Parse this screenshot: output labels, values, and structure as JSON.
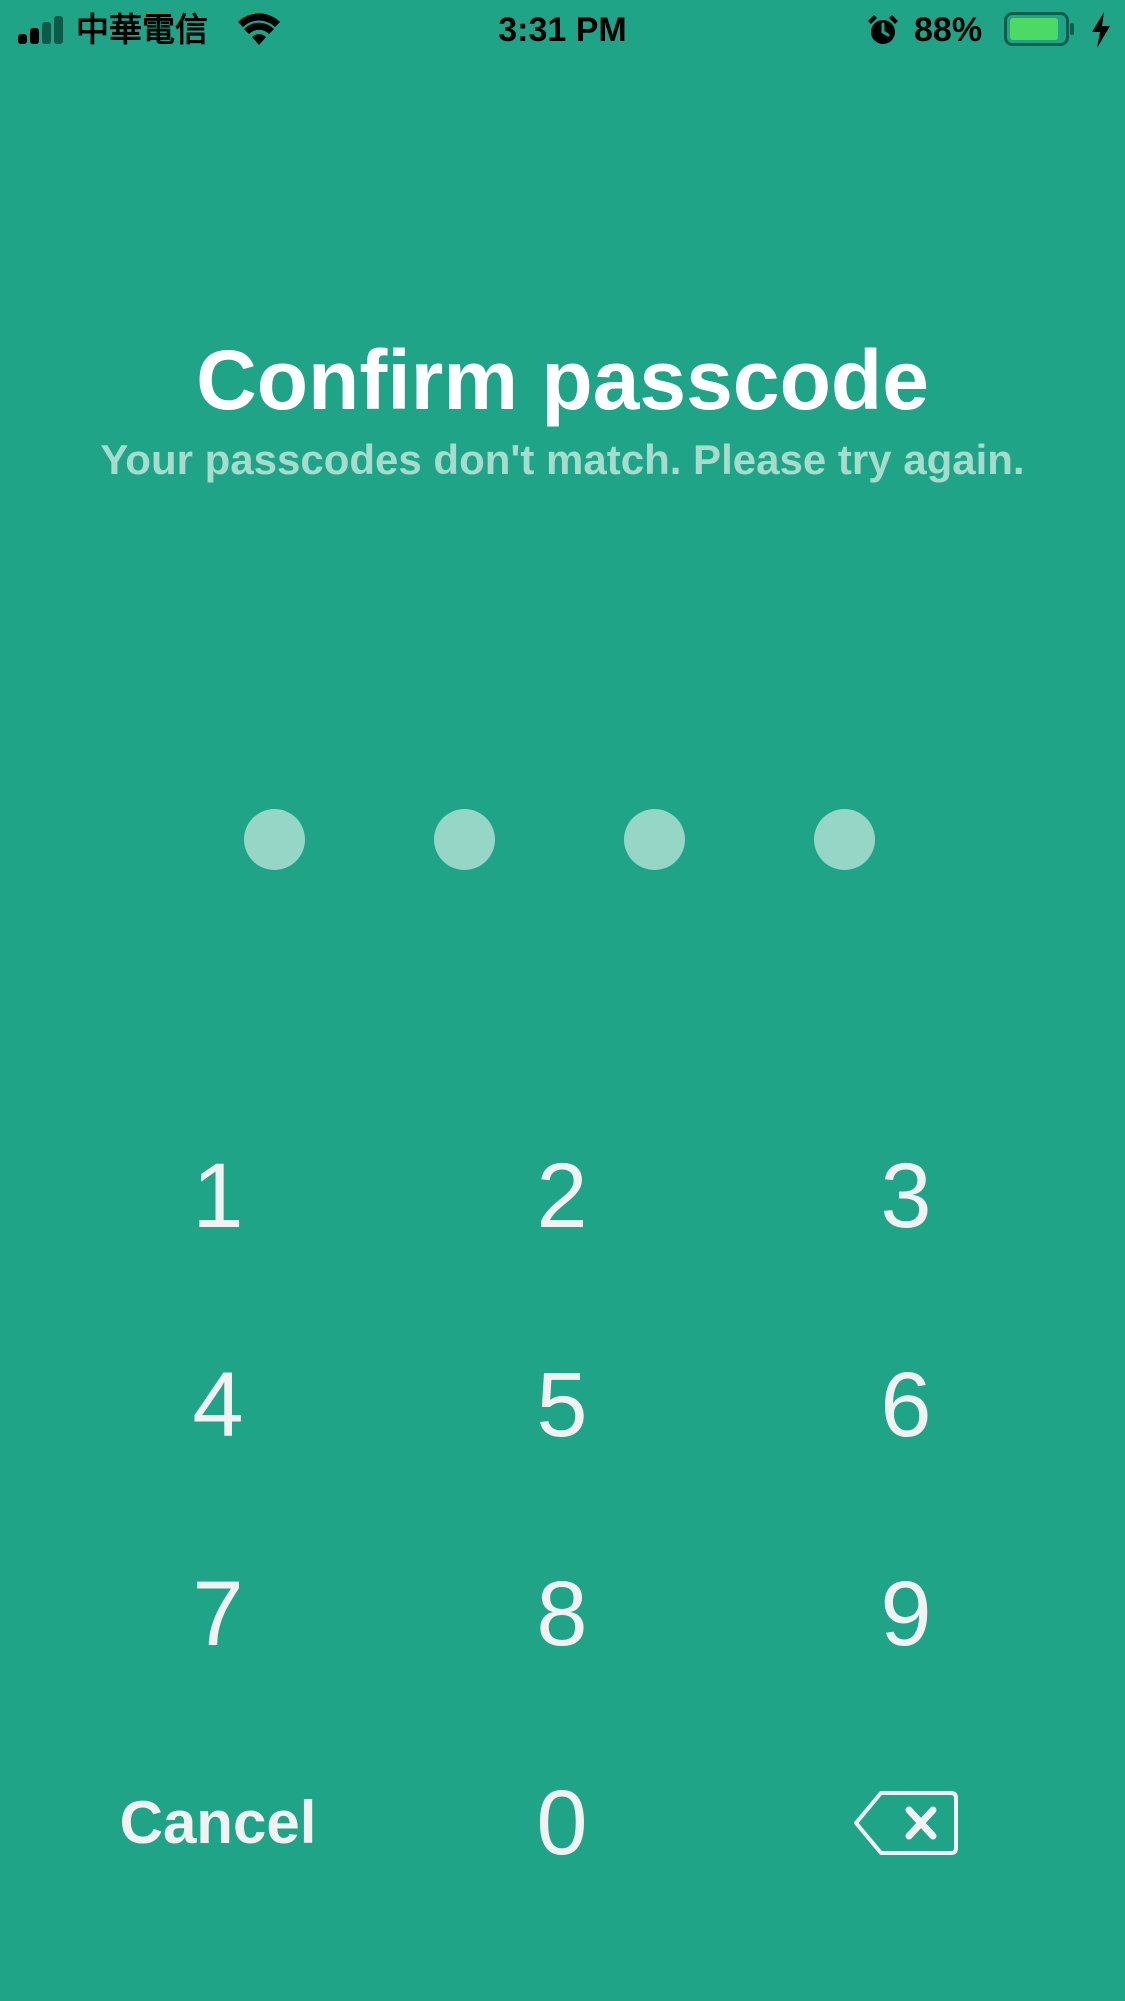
{
  "status_bar": {
    "carrier": "中華電信",
    "time": "3:31 PM",
    "battery_percent": "88%",
    "battery_level": 0.88,
    "battery_color": "#4cd964",
    "icons": [
      "signal-icon",
      "wifi-icon",
      "alarm-icon",
      "battery-icon",
      "charging-bolt-icon"
    ]
  },
  "header": {
    "title": "Confirm passcode",
    "subtitle": "Your passcodes don't match. Please try again."
  },
  "passcode": {
    "length": 4,
    "entered": 0
  },
  "keypad": {
    "keys": [
      "1",
      "2",
      "3",
      "4",
      "5",
      "6",
      "7",
      "8",
      "9",
      "0"
    ],
    "cancel_label": "Cancel",
    "delete_icon": "backspace-icon"
  },
  "colors": {
    "background": "#1fa488",
    "dot": "#95d6c6",
    "subtitle": "#a6dccd",
    "key_text": "#f2f2f2"
  }
}
